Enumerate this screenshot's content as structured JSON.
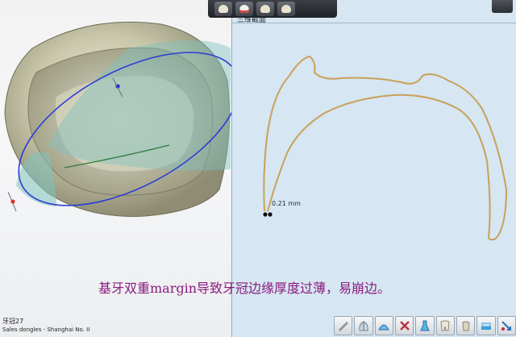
{
  "section_panel": {
    "title": "三维截面"
  },
  "measurement": {
    "value_label": "0.21 mm"
  },
  "caption": {
    "text": "基牙双重margin导致牙冠边缘厚度过薄，易崩边。"
  },
  "footer": {
    "title": "牙冠27",
    "subtitle": "Sales dongles - Shanghai No. II"
  },
  "top_toolbar": {
    "buttons": [
      "crown-view-1",
      "crown-view-2",
      "crown-view-3",
      "crown-view-4"
    ]
  },
  "bottom_tools": {
    "icons": [
      "sculpt-tool-icon",
      "crown-section-icon",
      "dome-icon",
      "delete-icon",
      "flask-icon",
      "tooth-shape-icon",
      "tooth-icon",
      "toothbrush-tool-icon",
      "remove-arrow-icon"
    ]
  },
  "colors": {
    "section_curve": "#c9a15a",
    "cut_plane": "#2d3bd6",
    "plane_fill": "#7fc2be",
    "caption": "#8b1a7e"
  }
}
